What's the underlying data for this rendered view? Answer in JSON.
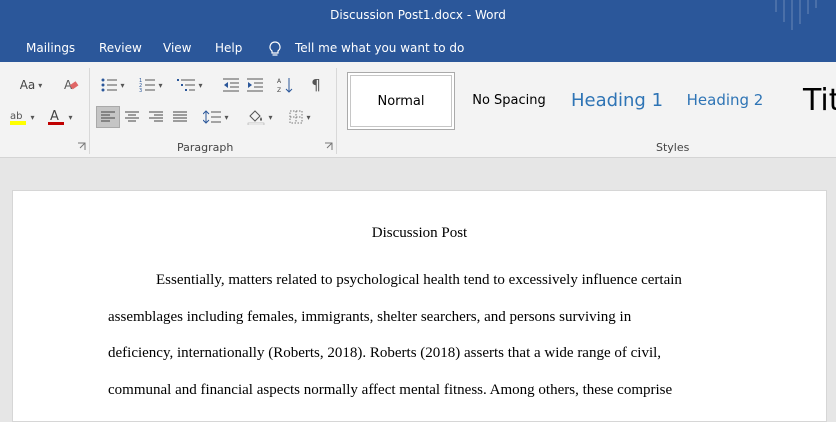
{
  "window": {
    "title": "Discussion Post1.docx  -  Word"
  },
  "tabs": [
    "Mailings",
    "Review",
    "View",
    "Help"
  ],
  "tell_me": "Tell me what you want to do",
  "ribbon": {
    "font_group": {
      "change_case": "Aa"
    },
    "paragraph_group": {
      "label": "Paragraph"
    },
    "styles_group": {
      "label": "Styles",
      "items": [
        "Normal",
        "No Spacing",
        "Heading 1",
        "Heading 2",
        "Tit"
      ]
    },
    "colors": {
      "highlight": "#ffff00",
      "font_color": "#c00000",
      "heading_blue": "#2e74b5"
    }
  },
  "document": {
    "title": "Discussion Post",
    "lines": [
      "Essentially, matters related to psychological health tend to excessively influence certain",
      "assemblages including females, immigrants, shelter searchers, and persons surviving in",
      "deficiency, internationally (Roberts, 2018). Roberts (2018) asserts that a wide range of civil,",
      "communal and financial aspects normally affect mental fitness. Among others, these comprise"
    ]
  }
}
